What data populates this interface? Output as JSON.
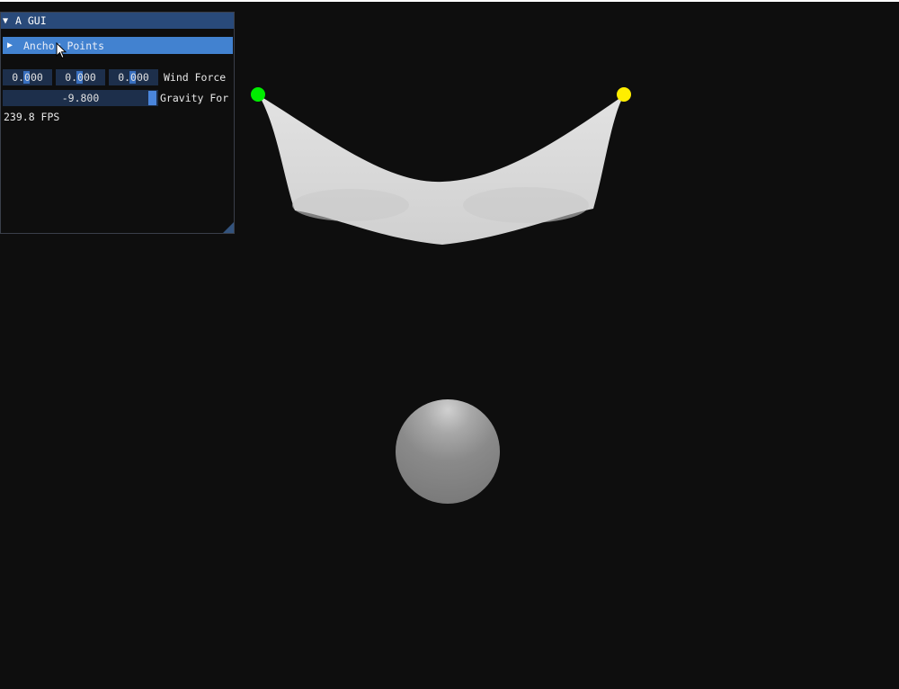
{
  "window": {
    "title": "A GUI",
    "title_arrow": "▼"
  },
  "anchor_points": {
    "arrow": "▶",
    "label": "Anchor Points"
  },
  "wind_force": {
    "label": "Wind Force",
    "x": "0.000",
    "y": "0.000",
    "z": "0.000"
  },
  "gravity_force": {
    "label": "Gravity For",
    "value": "-9.800"
  },
  "fps": "239.8 FPS",
  "scene": {
    "anchor_left_color": "#00ee00",
    "anchor_right_color": "#ffee00",
    "cloth_color": "#d8d8d8",
    "sphere_color": "#8a8a8a",
    "background": "#0e0e0e"
  },
  "icons": {
    "cursor": "mouse-pointer-icon"
  },
  "colors": {
    "title_bar": "#294a7a",
    "header_active": "#4282d0",
    "frame_bg": "#1d2f4b",
    "grab": "#4a85db"
  }
}
